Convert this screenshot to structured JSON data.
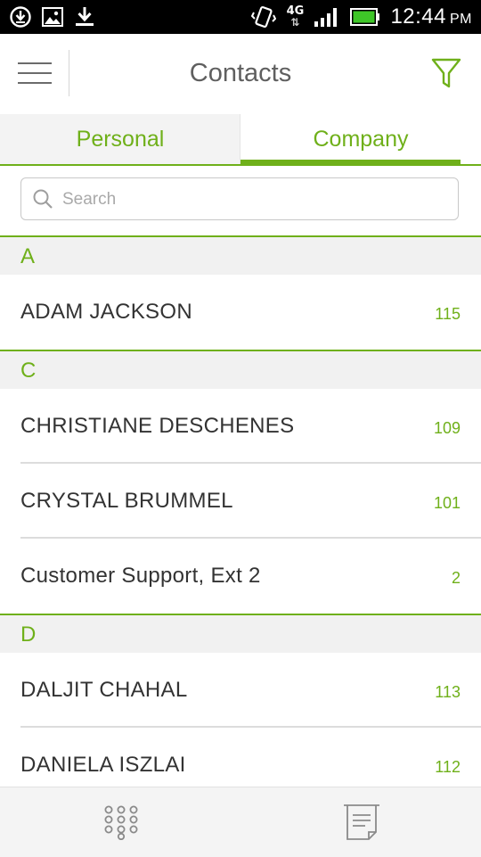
{
  "status_bar": {
    "icons_left": [
      "download-circle-icon",
      "image-icon",
      "download-icon"
    ],
    "network": "4G",
    "time": "12:44",
    "ampm": "PM"
  },
  "header": {
    "title": "Contacts"
  },
  "tabs": [
    {
      "label": "Personal",
      "active": false
    },
    {
      "label": "Company",
      "active": true
    }
  ],
  "search": {
    "placeholder": "Search",
    "value": ""
  },
  "sections": [
    {
      "letter": "A",
      "contacts": [
        {
          "name": "ADAM JACKSON",
          "ext": "115"
        }
      ]
    },
    {
      "letter": "C",
      "contacts": [
        {
          "name": "CHRISTIANE DESCHENES",
          "ext": "109"
        },
        {
          "name": "CRYSTAL BRUMMEL",
          "ext": "101"
        },
        {
          "name": "Customer Support, Ext 2",
          "ext": "2"
        }
      ]
    },
    {
      "letter": "D",
      "contacts": [
        {
          "name": "DALJIT CHAHAL",
          "ext": "113"
        },
        {
          "name": "DANIELA ISZLAI",
          "ext": "112"
        }
      ]
    }
  ],
  "colors": {
    "accent": "#6fb01a",
    "text": "#333333",
    "header_text": "#5f5f5f"
  },
  "bottom_bar": {
    "icons": [
      "dialpad-icon",
      "notes-icon"
    ]
  }
}
